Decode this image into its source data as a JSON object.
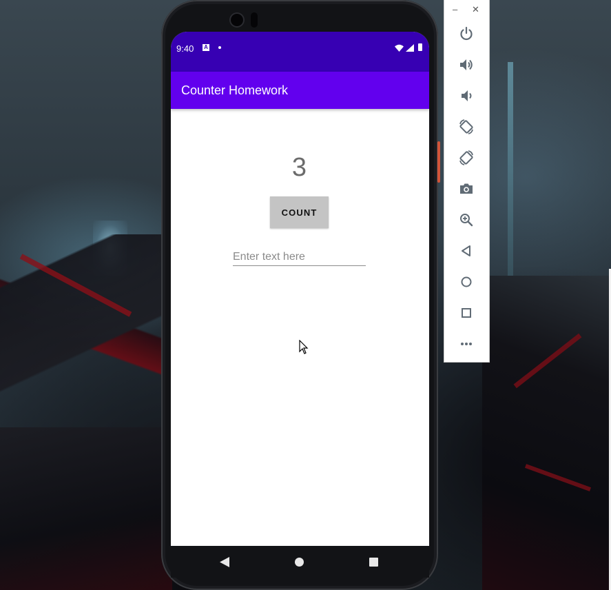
{
  "status_bar": {
    "time": "9:40",
    "notification_letter": "A"
  },
  "app": {
    "title": "Counter Homework",
    "count_value": "3",
    "count_button_label": "COUNT",
    "input_placeholder": "Enter text here",
    "input_value": ""
  },
  "emulator_toolbar": {
    "window_controls": {
      "minimize": "–",
      "close": "✕"
    },
    "buttons": [
      "power-icon",
      "volume-up-icon",
      "volume-down-icon",
      "rotate-left-icon",
      "rotate-right-icon",
      "camera-icon",
      "zoom-icon",
      "back-icon",
      "home-icon",
      "overview-icon",
      "more-icon"
    ]
  },
  "colors": {
    "status_bar": "#3700b3",
    "app_bar": "#6200ee",
    "button": "#c4c4c4",
    "toolbar_icon": "#606b75"
  }
}
